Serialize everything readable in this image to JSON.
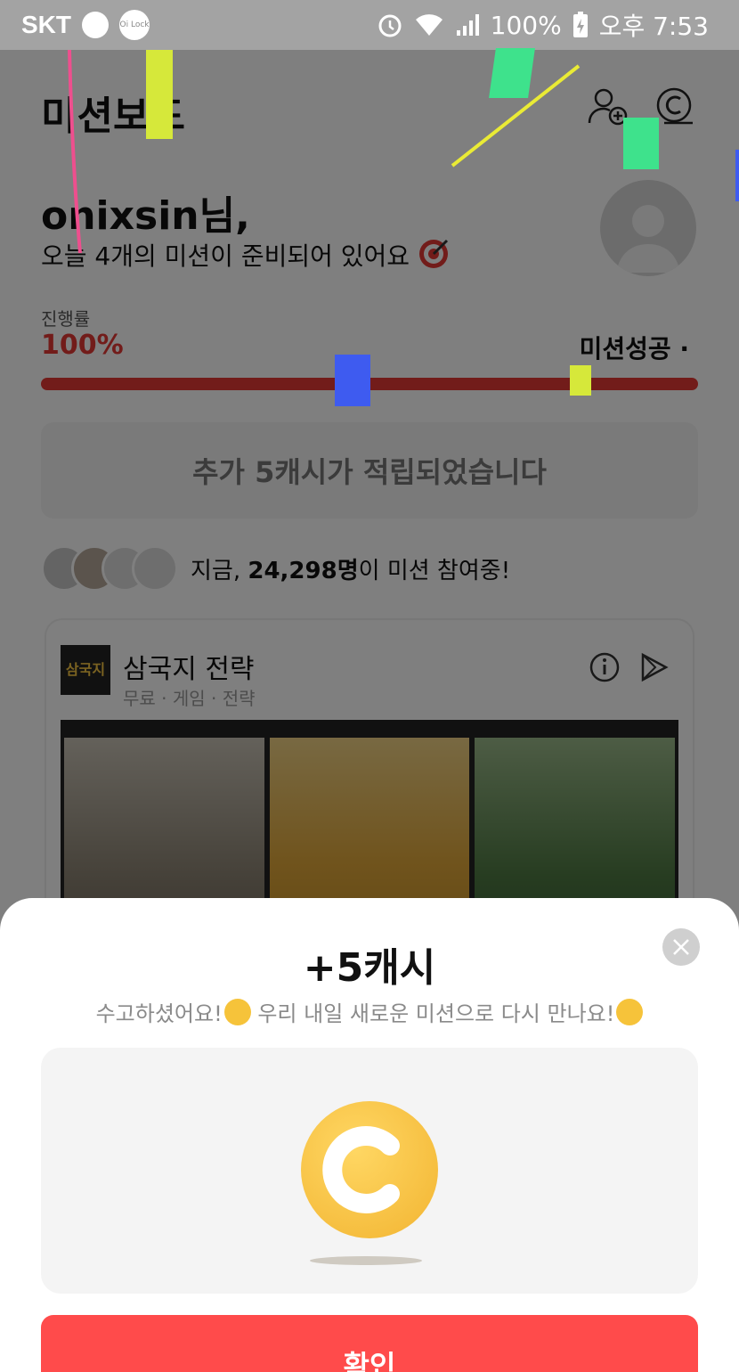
{
  "status_bar": {
    "carrier": "SKT",
    "lock_badge": "Oi Lock",
    "battery": "100%",
    "time": "오후 7:53"
  },
  "header": {
    "title": "미션보드",
    "icons": [
      "add-friend-icon",
      "cash-icon"
    ]
  },
  "greeting": {
    "name": "onixsin님,",
    "subtitle": "오늘 4개의 미션이 준비되어 있어요"
  },
  "progress": {
    "label": "진행률",
    "percent_text": "100%",
    "value": 1.0,
    "status": "미션성공 ·"
  },
  "notice": "추가 5캐시가 적립되었습니다",
  "participants": {
    "prefix": "지금, ",
    "count": "24,298명",
    "suffix": "이 미션 참여중!"
  },
  "app_card": {
    "logo_text": "삼국지",
    "name": "삼국지 전략",
    "tags": "무료 · 게임 · 전략"
  },
  "sheet": {
    "title": "+5캐시",
    "message_part1": "수고하셨어요!",
    "message_part2": " 우리 내일 새로운 미션으로 다시 만나요!",
    "confirm_label": "확인"
  },
  "colors": {
    "accent_red": "#e53935",
    "button_red": "#ff4b4b",
    "coin_gold": "#f2b431"
  }
}
